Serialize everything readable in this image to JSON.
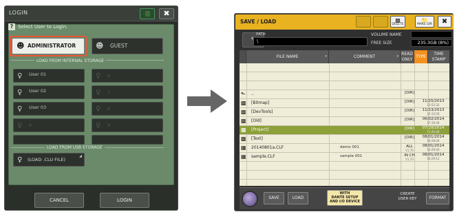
{
  "login": {
    "title": "LOGIN",
    "close_label": "✖",
    "prompt": "Select User to Login.",
    "help_icon": "?",
    "administrator_label": "ADMINISTRATOR",
    "guest_label": "GUEST",
    "internal_storage_label": "LOAD FROM INTERNAL STORAGE",
    "users": [
      "User 01",
      "User 02",
      "User 03"
    ],
    "slot_numbers": [
      "4",
      "5",
      "6",
      "7",
      "8",
      "9",
      "10"
    ],
    "usb_storage_label": "LOAD FROM USB STORAGE",
    "usb_button_label": "(LOAD .CLU FILE)",
    "cancel_label": "CANCEL",
    "login_label": "LOGIN",
    "accent_color": "#e53"
  },
  "save_load": {
    "title": "SAVE / LOAD",
    "close_label": "✖",
    "toolbar": {
      "delete_label": "DELETE",
      "make_dir_label": "MAKE DIR"
    },
    "path_label": "PATH",
    "path_value": "\\",
    "volume_name_label": "VOLUME NAME",
    "free_size_label": "FREE SIZE",
    "free_size_value": "235.3GB (8%)",
    "columns": {
      "file_name": "FILE NAME",
      "comment": "COMMENT",
      "read_only_1": "READ",
      "read_only_2": "ONLY",
      "type": "TYPE",
      "time_stamp_1": "TIME",
      "time_stamp_2": "STAMP"
    },
    "rows": [
      {
        "icon": "up",
        "name": "..",
        "comment": "",
        "type": "[DIR]",
        "type_sub": "",
        "date": "",
        "time": "",
        "selected": false
      },
      {
        "icon": "folder",
        "name": "[Bitmap]",
        "comment": "",
        "type": "[DIR]",
        "type_sub": "",
        "date": "11/15/2013",
        "time": "13:52:32",
        "selected": false
      },
      {
        "icon": "folder",
        "name": "[DevTools]",
        "comment": "",
        "type": "[DIR]",
        "type_sub": "",
        "date": "11/13/2013",
        "time": "15:12:50",
        "selected": false
      },
      {
        "icon": "folder",
        "name": "[Old]",
        "comment": "",
        "type": "[DIR]",
        "type_sub": "",
        "date": "06/02/2014",
        "time": "17:19:30",
        "selected": false
      },
      {
        "icon": "folder",
        "name": "[Project]",
        "comment": "",
        "type": "[DIR]",
        "type_sub": "",
        "date": "07/29/2014",
        "time": "11:44:36",
        "selected": true
      },
      {
        "icon": "folder",
        "name": "[Text]",
        "comment": "",
        "type": "[DIR]",
        "type_sub": "",
        "date": "08/01/2014",
        "time": "16:28:44",
        "selected": false
      },
      {
        "icon": "file",
        "name": "20140801a.CLF",
        "comment": "demo 001",
        "type": "ALL",
        "type_sub": "V1.70",
        "date": "08/01/2014",
        "time": "16:29:20",
        "selected": false
      },
      {
        "icon": "file",
        "name": "sample.CLF",
        "comment": "sample 001",
        "type": "IN CH",
        "type_sub": "V1.70",
        "date": "08/01/2014",
        "time": "16:29:12",
        "selected": false
      }
    ],
    "buttons": {
      "save": "SAVE",
      "load": "LOAD",
      "dante_1": "WITH",
      "dante_2": "DANTE SETUP",
      "dante_3": "AND I/O DEVICE",
      "create_1": "CREATE",
      "create_2": "USER KEY",
      "format": "FORMAT"
    },
    "accent_color": "#e8b220",
    "selected_row_color": "#8da03a",
    "type_header_color": "#f29020"
  }
}
